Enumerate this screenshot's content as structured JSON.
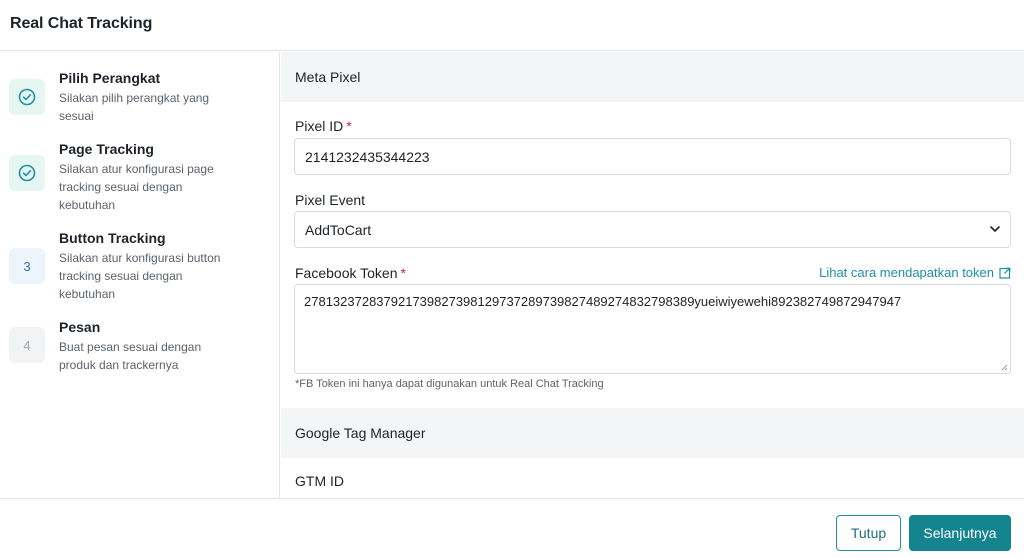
{
  "header": {
    "title": "Real Chat Tracking"
  },
  "steps": [
    {
      "icon": "check-circle-icon",
      "number": "",
      "title": "Pilih Perangkat",
      "description": "Silakan pilih perangkat yang sesuai",
      "status": "done"
    },
    {
      "icon": "check-circle-icon",
      "number": "",
      "title": "Page Tracking",
      "description": "Silakan atur konfigurasi page tracking sesuai dengan kebutuhan",
      "status": "done"
    },
    {
      "icon": "",
      "number": "3",
      "title": "Button Tracking",
      "description": "Silakan atur konfigurasi button tracking sesuai dengan kebutuhan",
      "status": "active"
    },
    {
      "icon": "",
      "number": "4",
      "title": "Pesan",
      "description": "Buat pesan sesuai dengan produk dan trackernya",
      "status": "todo"
    }
  ],
  "meta_pixel": {
    "section_title": "Meta Pixel",
    "pixel_id_label": "Pixel ID",
    "pixel_id_value": "2141232435344223",
    "pixel_event_label": "Pixel Event",
    "pixel_event_value": "AddToCart",
    "facebook_token_label": "Facebook Token",
    "facebook_token_link": "Lihat cara mendapatkan token",
    "facebook_token_value": "278132372837921739827398129737289739827489274832798389yueiwiyewehi892382749872947947",
    "facebook_token_hint": "*FB Token ini hanya dapat digunakan untuk Real Chat Tracking",
    "required_mark": "*"
  },
  "gtm": {
    "section_title": "Google Tag Manager",
    "gtm_id_label": "GTM ID"
  },
  "footer": {
    "close_label": "Tutup",
    "next_label": "Selanjutnya"
  },
  "colors": {
    "accent": "#14848f",
    "required": "#d6213d",
    "link": "#1f8fa3",
    "done_bg": "#e6f6f3",
    "active_bg": "#eef4fc"
  }
}
